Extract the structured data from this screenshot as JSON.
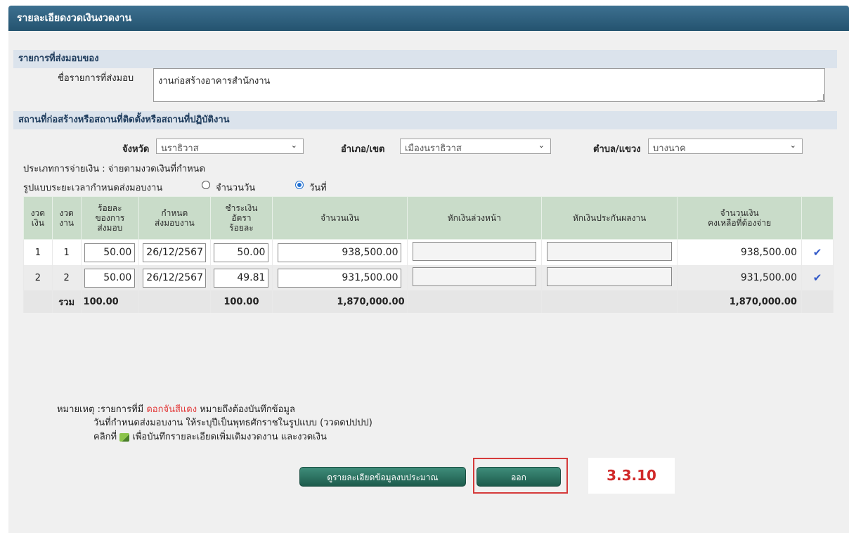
{
  "title": "รายละเอียดงวดเงินงวดงาน",
  "section_delivery": "รายการที่ส่งมอบของ",
  "delivery_label": "ชื่อรายการที่ส่งมอบ",
  "delivery_value": "งานก่อสร้างอาคารสำนักงาน",
  "section_location": "สถานที่ก่อสร้างหรือสถานที่ติดตั้งหรือสถานที่ปฏิบัติงาน",
  "province_label": "จังหวัด",
  "province_value": "นราธิวาส",
  "district_label": "อำเภอ/เขต",
  "district_value": "เมืองนราธิวาส",
  "subdistrict_label": "ตำบล/แขวง",
  "subdistrict_value": "บางนาค",
  "payment_type": "ประเภทการจ่ายเงิน : จ่ายตามงวดเงินที่กำหนด",
  "schedule_label": "รูปแบบระยะเวลากำหนดส่งมอบงาน",
  "radio_days": "จำนวนวัน",
  "radio_date": "วันที่",
  "table": {
    "headers": [
      "งวด\nเงิน",
      "งวด\nงาน",
      "ร้อยละ\nของการ\nส่งมอบ",
      "กำหนด\nส่งมอบงาน",
      "ชำระเงิน\nอัตรา\nร้อยละ",
      "จำนวนเงิน",
      "หักเงินล่วงหน้า",
      "หักเงินประกันผลงาน",
      "จำนวนเงิน\nคงเหลือที่ต้องจ่าย",
      ""
    ],
    "rows": [
      {
        "pay": "1",
        "work": "1",
        "pct": "50.00",
        "date": "26/12/2567",
        "rate": "50.00",
        "amount": "938,500.00",
        "advance": "",
        "retention": "",
        "remaining": "938,500.00"
      },
      {
        "pay": "2",
        "work": "2",
        "pct": "50.00",
        "date": "26/12/2567",
        "rate": "49.81",
        "amount": "931,500.00",
        "advance": "",
        "retention": "",
        "remaining": "931,500.00"
      }
    ],
    "total": {
      "label": "รวม",
      "pct": "100.00",
      "rate": "100.00",
      "amount": "1,870,000.00",
      "remaining": "1,870,000.00"
    }
  },
  "note": {
    "prefix": "หมายเหตุ :รายการที่มี",
    "red_text": "ดอกจันสีแดง",
    "suffix": "หมายถึงต้องบันทึกข้อมูล",
    "line2": "วันที่กำหนดส่งมอบงาน ให้ระบุปีเป็นพุทธศักราชในรูปแบบ (ววดดปปปป)",
    "line3a": "คลิกที่",
    "line3b": "เพื่อบันทึกรายละเอียดเพิ่มเติมงวดงาน และงวดเงิน"
  },
  "btn_budget": "ดูรายละเอียดข้อมูลงบประมาณ",
  "btn_exit": "ออก",
  "step_tag": "3.3.10"
}
